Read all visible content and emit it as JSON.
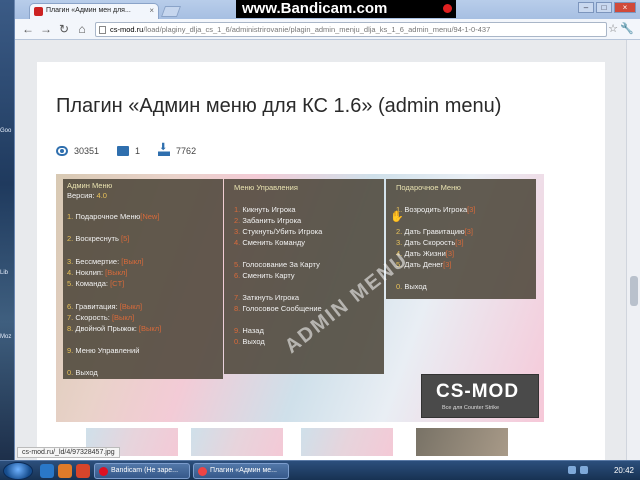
{
  "recorder": {
    "watermark": "www.Bandicam.com"
  },
  "desktop": {
    "labels": [
      "Goo",
      "Lib",
      "Moz"
    ]
  },
  "browser": {
    "tab_title": "Плагин «Админ мен для...",
    "tab_close": "×",
    "window_controls": {
      "minimize": "–",
      "maximize": "□",
      "close": "×"
    },
    "nav": {
      "back": "←",
      "forward": "→",
      "reload": "↻",
      "home": "⌂"
    },
    "url_host": "cs-mod.ru",
    "url_path": "/load/plaginy_dlja_cs_1_6/administrirovanie/plagin_admin_menju_dlja_ks_1_6_admin_menu/94-1-0-437",
    "star": "☆",
    "menu": "🔧"
  },
  "page": {
    "title": "Плагин «Админ меню для КС 1.6» (admin menu)",
    "stats": {
      "views": "30351",
      "comments": "1",
      "downloads": "7762"
    },
    "status_url": "cs-mod.ru/_ld/4/97328457.jpg"
  },
  "screenshot": {
    "col1": {
      "header": "Админ Меню",
      "version_label": "Версия:",
      "version": "4.0",
      "items": [
        {
          "n": "1.",
          "text": "Подарочное Меню",
          "tag": "[New]"
        },
        {
          "n": "2.",
          "text": "Воскреснуть",
          "tag": "[5]"
        },
        {
          "n": "3.",
          "text": "Бессмертие:",
          "tag": "[Выкл]"
        },
        {
          "n": "4.",
          "text": "Ноклип:",
          "tag": "[Выкл]"
        },
        {
          "n": "5.",
          "text": "Команда:",
          "tag": "[CT]"
        },
        {
          "n": "6.",
          "text": "Гравитация:",
          "tag": "[Выкл]"
        },
        {
          "n": "7.",
          "text": "Скорость:",
          "tag": "[Выкл]"
        },
        {
          "n": "8.",
          "text": "Двойной Прыжок:",
          "tag": "[Выкл]"
        },
        {
          "n": "9.",
          "text": "Меню Управлений",
          "tag": ""
        },
        {
          "n": "0.",
          "text": "Выход",
          "tag": ""
        }
      ]
    },
    "col2": {
      "header": "Меню Управления",
      "items": [
        {
          "n": "1.",
          "text": "Кикнуть Игрока"
        },
        {
          "n": "2.",
          "text": "Забанить Игрока"
        },
        {
          "n": "3.",
          "text": "Стукнуть/Убить Игрока"
        },
        {
          "n": "4.",
          "text": "Сменить Команду"
        },
        {
          "n": "5.",
          "text": "Голосование За Карту"
        },
        {
          "n": "6.",
          "text": "Сменить Карту"
        },
        {
          "n": "7.",
          "text": "Заткнуть Игрока"
        },
        {
          "n": "8.",
          "text": "Голосовое Сообщение"
        },
        {
          "n": "9.",
          "text": "Назад"
        },
        {
          "n": "0.",
          "text": "Выход"
        }
      ]
    },
    "col3": {
      "header": "Подарочное Меню",
      "items": [
        {
          "n": "1.",
          "text": "Возродить Игрока",
          "tag": "[3]"
        },
        {
          "n": "2.",
          "text": "Дать Гравитацию",
          "tag": "[3]"
        },
        {
          "n": "3.",
          "text": "Дать Скорость",
          "tag": "[3]"
        },
        {
          "n": "4.",
          "text": "Дать Жизни",
          "tag": "[3]"
        },
        {
          "n": "5.",
          "text": "Дать Денег",
          "tag": "[3]"
        },
        {
          "n": "0.",
          "text": "Выход",
          "tag": ""
        }
      ]
    },
    "watermark": "ADMIN MENU",
    "logo_title": "CS-MOD",
    "logo_subtitle": "Все для Counter Strike"
  },
  "taskbar": {
    "tasks": [
      "Bandicam (Не заре...",
      "Плагин «Админ ме..."
    ],
    "clock": "20:42"
  },
  "colors": {
    "accent": "#2f6fae",
    "menu_bg": "#4d473a",
    "menu_tag": "#d96a3a",
    "menu_num": "#e8c25a"
  }
}
